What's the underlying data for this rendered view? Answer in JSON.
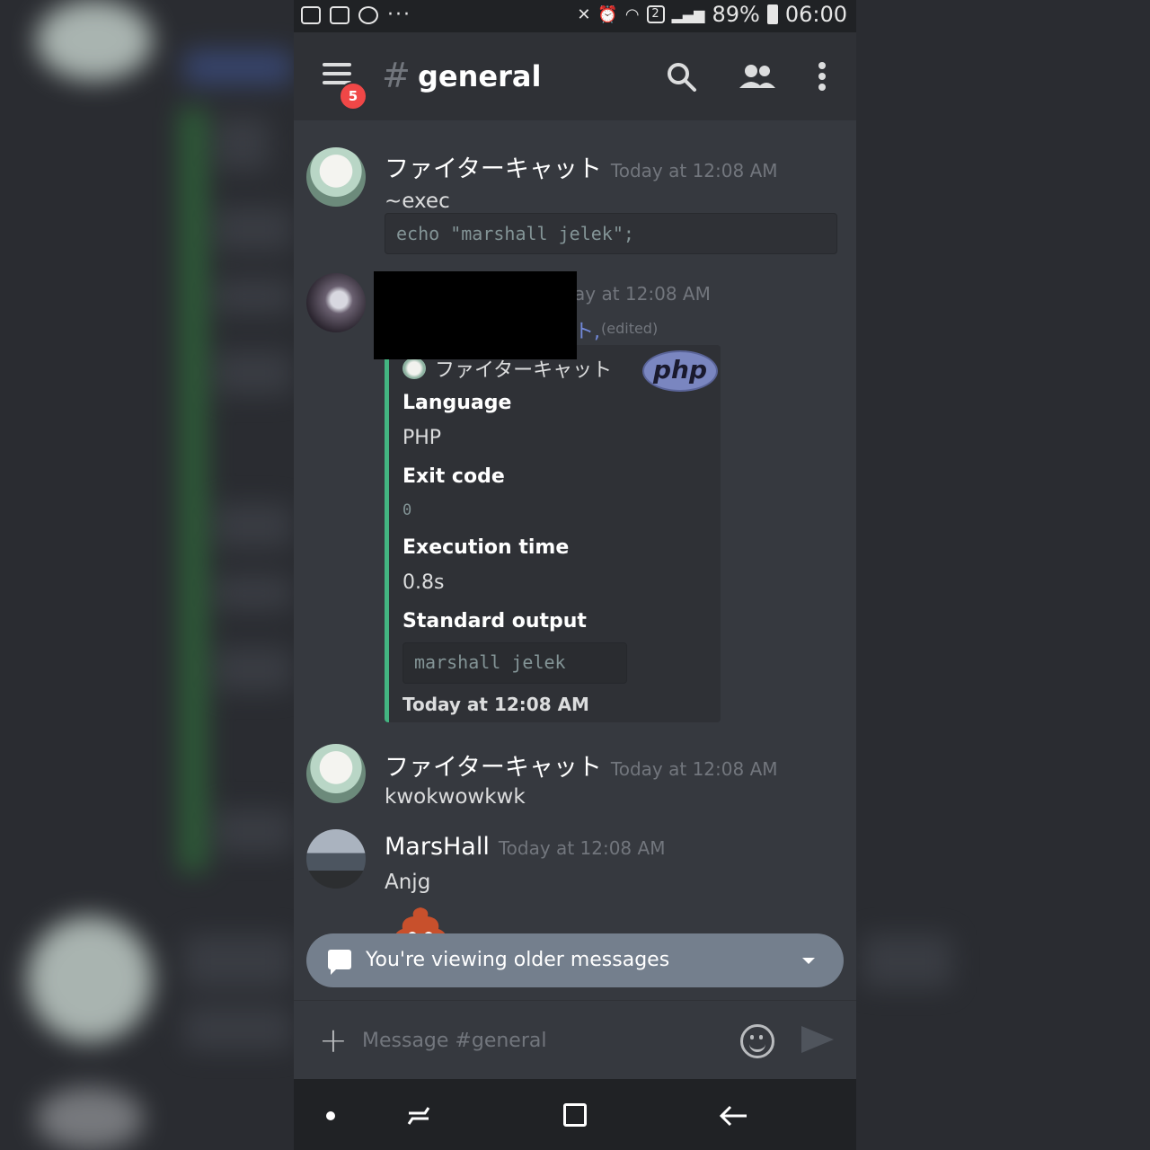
{
  "statusbar": {
    "battery": "89%",
    "time": "06:00",
    "sim": "2"
  },
  "header": {
    "hash": "#",
    "channel": "general",
    "badge": "5"
  },
  "messages": [
    {
      "author": "ファイターキャット",
      "time": "Today at 12:08 AM",
      "text": "~exec",
      "code": "echo \"marshall jelek\";"
    },
    {
      "time_fragment": "ay at 12:08 AM",
      "mention_fragment": "ト,",
      "edited": "(edited)"
    },
    {
      "author": "ファイターキャット",
      "time": "Today at 12:08 AM",
      "text": "kwokwowkwk"
    },
    {
      "author": "MarsHall",
      "time": "Today at 12:08 AM",
      "text": "Anjg"
    }
  ],
  "embed": {
    "author": "ファイターキャット",
    "logo": "php",
    "fields": [
      {
        "name": "Language",
        "value": "PHP"
      },
      {
        "name": "Exit code",
        "value": "0"
      },
      {
        "name": "Execution time",
        "value": "0.8s"
      },
      {
        "name": "Standard output",
        "value": "marshall jelek"
      }
    ],
    "footer": "Today at 12:08 AM",
    "accent": "#43b581"
  },
  "older_bar": {
    "text": "You're viewing older messages"
  },
  "composer": {
    "placeholder": "Message #general"
  }
}
